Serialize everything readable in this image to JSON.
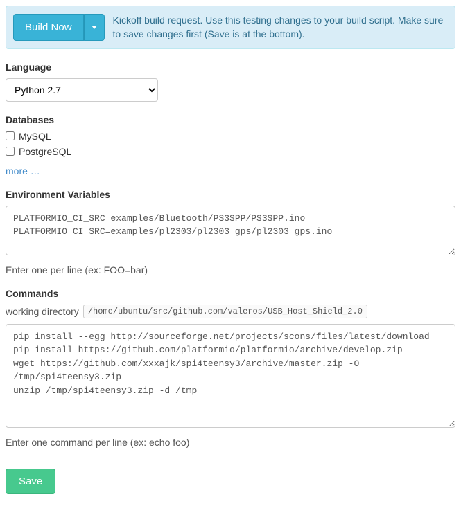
{
  "alert": {
    "build_button": "Build Now",
    "text": "Kickoff build request. Use this testing changes to your build script. Make sure to save changes first (Save is at the bottom)."
  },
  "language": {
    "label": "Language",
    "selected": "Python 2.7"
  },
  "databases": {
    "label": "Databases",
    "items": [
      {
        "label": "MySQL",
        "checked": false
      },
      {
        "label": "PostgreSQL",
        "checked": false
      }
    ],
    "more": "more …"
  },
  "envvars": {
    "label": "Environment Variables",
    "value": "PLATFORMIO_CI_SRC=examples/Bluetooth/PS3SPP/PS3SPP.ino\nPLATFORMIO_CI_SRC=examples/pl2303/pl2303_gps/pl2303_gps.ino",
    "hint": "Enter one per line (ex: FOO=bar)"
  },
  "commands": {
    "label": "Commands",
    "working_dir_label": "working directory",
    "working_dir": "/home/ubuntu/src/github.com/valeros/USB_Host_Shield_2.0",
    "value": "pip install --egg http://sourceforge.net/projects/scons/files/latest/download\npip install https://github.com/platformio/platformio/archive/develop.zip\nwget https://github.com/xxxajk/spi4teensy3/archive/master.zip -O /tmp/spi4teensy3.zip\nunzip /tmp/spi4teensy3.zip -d /tmp",
    "hint": "Enter one command per line (ex: echo foo)"
  },
  "save_button": "Save"
}
